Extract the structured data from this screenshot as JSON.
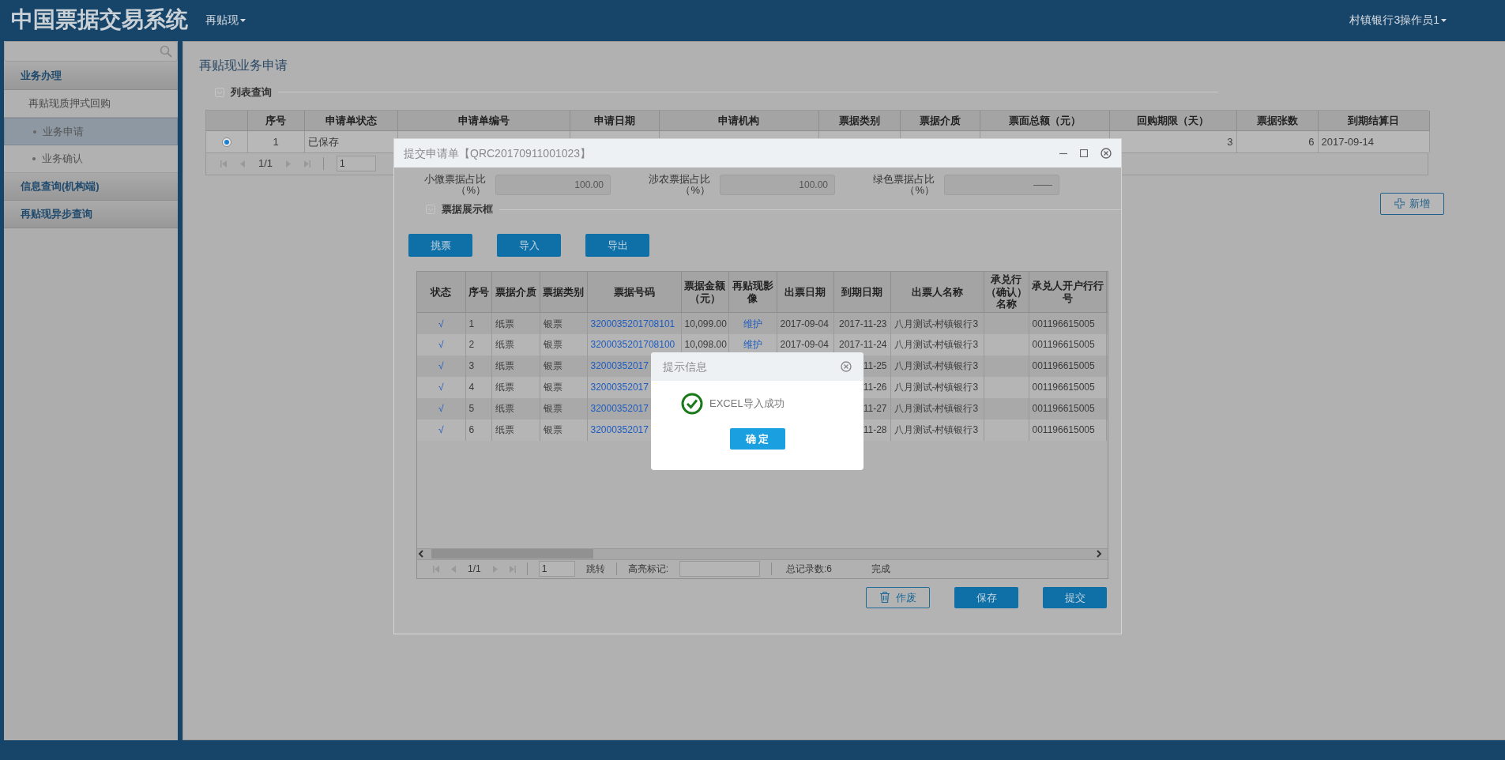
{
  "header": {
    "title": "中国票据交易系统",
    "menu": [
      {
        "label": "再贴现",
        "selected": false
      }
    ],
    "user": "村镇银行3操作员1"
  },
  "sidebar": {
    "sections": [
      {
        "label": "业务办理",
        "children": [
          {
            "label": "再贴现质押式回购",
            "children": [
              {
                "label": "业务申请",
                "selected": true
              },
              {
                "label": "业务确认",
                "selected": false
              }
            ]
          }
        ]
      },
      {
        "label": "信息查询(机构端)"
      },
      {
        "label": "再贴现异步查询"
      }
    ]
  },
  "page": {
    "title": "再贴现业务申请",
    "legend": "列表查询",
    "table": {
      "columns": [
        "序号",
        "申请单状态",
        "申请单编号",
        "申请日期",
        "申请机构",
        "票据类别",
        "票据介质",
        "票面总额（元）",
        "回购期限（天）",
        "票据张数",
        "到期结算日"
      ],
      "rows": [
        {
          "selected": true,
          "cells": [
            "1",
            "已保存"
          ],
          "tail_cells": [
            "3",
            "6",
            "2017-09-14"
          ]
        }
      ]
    },
    "pager": {
      "page": "1/1",
      "page_input": "1"
    },
    "add_button": "新增"
  },
  "dialog": {
    "title": "提交申请单【QRC20170911001023】",
    "fields": [
      {
        "label": "小微票据占比（%）",
        "value": "100.00"
      },
      {
        "label": "涉农票据占比（%）",
        "value": "100.00"
      },
      {
        "label": "绿色票据占比（%）",
        "value": "——"
      }
    ],
    "legend": "票据展示框",
    "buttons": [
      "挑票",
      "导入",
      "导出"
    ],
    "table": {
      "columns": [
        "状态",
        "序号",
        "票据介质",
        "票据类别",
        "票据号码",
        "票据金额（元）",
        "再贴现影像",
        "出票日期",
        "到期日期",
        "出票人名称",
        "承兑行（确认）名称",
        "承兑人开户行行号"
      ],
      "rows": [
        {
          "status": "√",
          "seq": "1",
          "medium": "纸票",
          "type": "银票",
          "number": "3200035201708101",
          "amount": "10,099.00",
          "image": "维护",
          "issue_date": "2017-09-04",
          "due_date": "2017-11-23",
          "drawer": "八月测试-村镇银行3",
          "bank_no": "001196615005"
        },
        {
          "status": "√",
          "seq": "2",
          "medium": "纸票",
          "type": "银票",
          "number": "3200035201708100",
          "amount": "10,098.00",
          "image": "维护",
          "issue_date": "2017-09-04",
          "due_date": "2017-11-24",
          "drawer": "八月测试-村镇银行3",
          "bank_no": "001196615005"
        },
        {
          "status": "√",
          "seq": "3",
          "medium": "纸票",
          "type": "银票",
          "number": "32000352017",
          "due_date": "11-25",
          "drawer": "八月测试-村镇银行3",
          "bank_no": "001196615005"
        },
        {
          "status": "√",
          "seq": "4",
          "medium": "纸票",
          "type": "银票",
          "number": "32000352017",
          "due_date": "11-26",
          "drawer": "八月测试-村镇银行3",
          "bank_no": "001196615005"
        },
        {
          "status": "√",
          "seq": "5",
          "medium": "纸票",
          "type": "银票",
          "number": "32000352017",
          "due_date": "11-27",
          "drawer": "八月测试-村镇银行3",
          "bank_no": "001196615005"
        },
        {
          "status": "√",
          "seq": "6",
          "medium": "纸票",
          "type": "银票",
          "number": "32000352017",
          "due_date": "11-28",
          "drawer": "八月测试-村镇银行3",
          "bank_no": "001196615005"
        }
      ]
    },
    "pager": {
      "page": "1/1",
      "page_input": "1",
      "jump": "跳转",
      "highlight_label": "高亮标记:",
      "total": "总记录数:6",
      "status": "完成"
    },
    "footer_buttons": [
      {
        "kind": "discard",
        "label": "作废"
      },
      {
        "kind": "primary",
        "label": "保存"
      },
      {
        "kind": "primary",
        "label": "提交"
      }
    ]
  },
  "alert": {
    "title": "提示信息",
    "message": "EXCEL导入成功",
    "button": "确 定"
  }
}
